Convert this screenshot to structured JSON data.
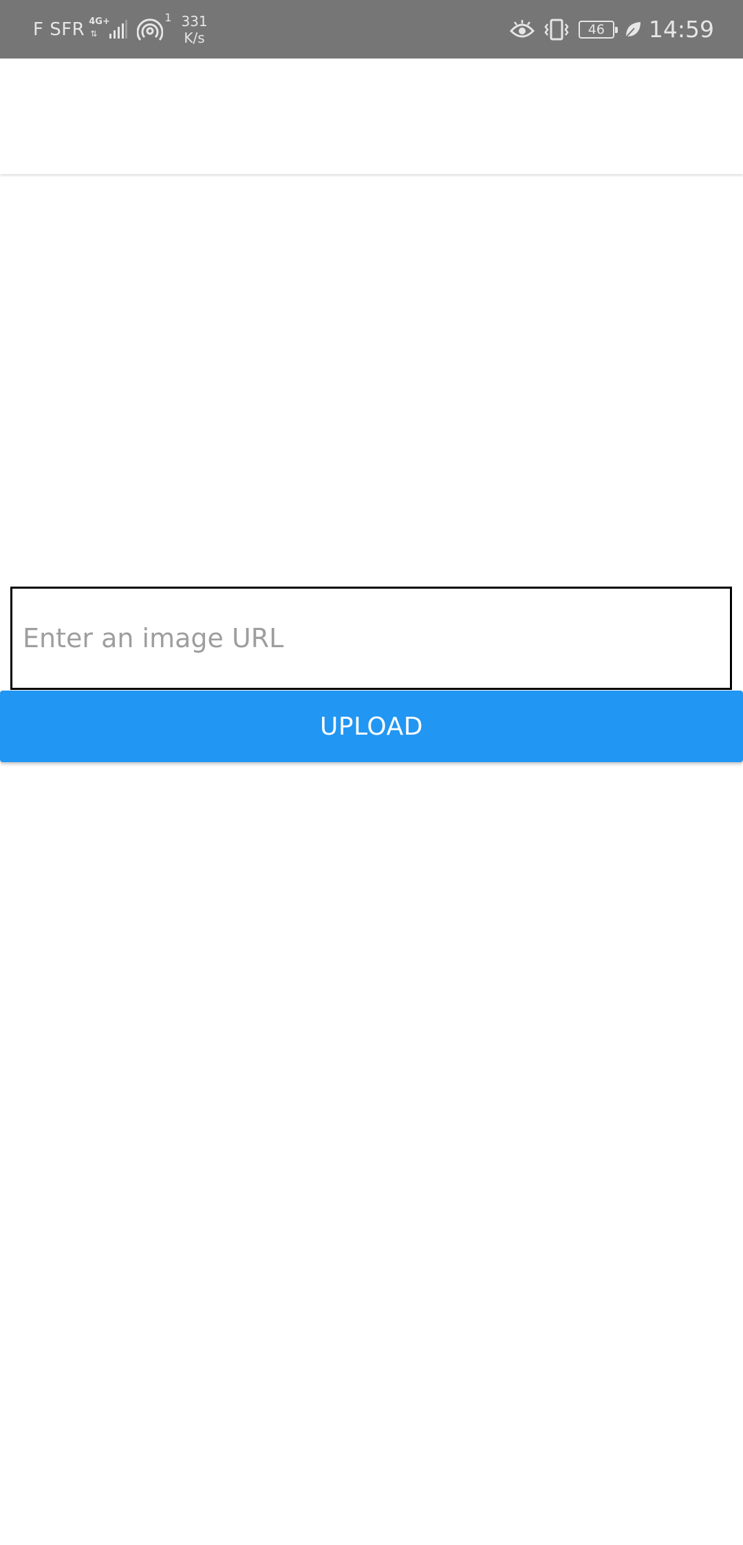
{
  "status_bar": {
    "carrier": "F SFR",
    "network_type": "4G+",
    "hotspot_count": "1",
    "speed_value": "331",
    "speed_unit": "K/s",
    "battery_level": "46",
    "time": "14:59",
    "icons": [
      "signal-icon",
      "hotspot-icon",
      "eye-comfort-icon",
      "vibrate-icon",
      "battery-icon",
      "leaf-icon"
    ]
  },
  "form": {
    "url_placeholder": "Enter an image URL",
    "url_value": "",
    "upload_label": "UPLOAD"
  },
  "colors": {
    "status_bar": "#767676",
    "primary": "#2196f3",
    "input_border": "#000000",
    "placeholder": "#9e9e9e"
  }
}
